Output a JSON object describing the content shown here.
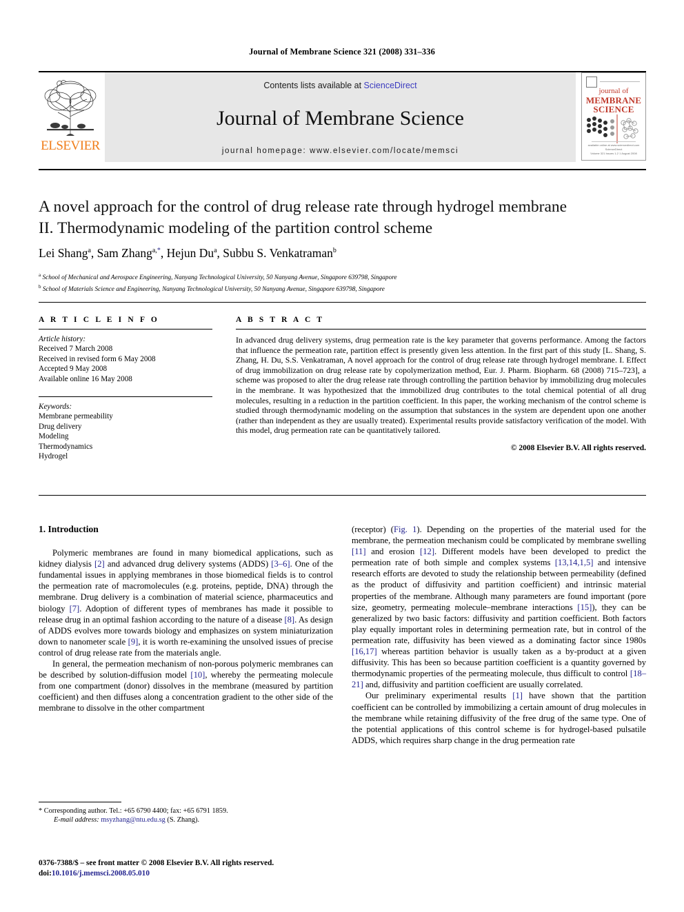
{
  "running_head": "Journal of Membrane Science 321 (2008) 331–336",
  "masthead": {
    "contents_prefix": "Contents lists available at ",
    "sciencedirect": "ScienceDirect",
    "journal_name": "Journal of Membrane Science",
    "homepage": "journal homepage: www.elsevier.com/locate/memsci",
    "publisher": "ELSEVIER",
    "publisher_logo_icon": "elsevier-tree-icon",
    "cover": {
      "line1": "journal of",
      "line2": "MEMBRANE",
      "line3": "SCIENCE",
      "footer_line1": "available online at www.sciencedirect.com",
      "footer_line2": "ScienceDirect",
      "footer_line3": "Volume 321  Issues 1-2  1 August 2008",
      "accent_color": "#c0392b"
    },
    "link_color": "#3b3bbf",
    "band_color": "#e7e7e7"
  },
  "title": {
    "line1": "A novel approach for the control of drug release rate through hydrogel membrane",
    "line2": "II. Thermodynamic modeling of the partition control scheme"
  },
  "authors": {
    "list": [
      {
        "name": "Lei Shang",
        "sup": "a"
      },
      {
        "name": "Sam Zhang",
        "sup": "a,"
      },
      {
        "name": "Hejun Du",
        "sup": "a"
      },
      {
        "name": "Subbu S. Venkatraman",
        "sup": "b"
      }
    ],
    "corresponding_marker": "*"
  },
  "affiliations": [
    {
      "sup": "a",
      "text": "School of Mechanical and Aerospace Engineering, Nanyang Technological University, 50 Nanyang Avenue, Singapore 639798, Singapore"
    },
    {
      "sup": "b",
      "text": "School of Materials Science and Engineering, Nanyang Technological University, 50 Nanyang Avenue, Singapore 639798, Singapore"
    }
  ],
  "article_info": {
    "heading": "A R T I C L E    I N F O",
    "history_label": "Article history:",
    "history": [
      "Received 7 March 2008",
      "Received in revised form 6 May 2008",
      "Accepted 9 May 2008",
      "Available online 16 May 2008"
    ],
    "keywords_label": "Keywords:",
    "keywords": [
      "Membrane permeability",
      "Drug delivery",
      "Modeling",
      "Thermodynamics",
      "Hydrogel"
    ]
  },
  "abstract": {
    "heading": "A B S T R A C T",
    "text": "In advanced drug delivery systems, drug permeation rate is the key parameter that governs performance. Among the factors that influence the permeation rate, partition effect is presently given less attention. In the first part of this study [L. Shang, S. Zhang, H. Du, S.S. Venkatraman, A novel approach for the control of drug release rate through hydrogel membrane. I. Effect of drug immobilization on drug release rate by copolymerization method, Eur. J. Pharm. Biopharm. 68 (2008) 715–723], a scheme was proposed to alter the drug release rate through controlling the partition behavior by immobilizing drug molecules in the membrane. It was hypothesized that the immobilized drug contributes to the total chemical potential of all drug molecules, resulting in a reduction in the partition coefficient. In this paper, the working mechanism of the control scheme is studied through thermodynamic modeling on the assumption that substances in the system are dependent upon one another (rather than independent as they are usually treated). Experimental results provide satisfactory verification of the model. With this model, drug permeation rate can be quantitatively tailored.",
    "copyright": "© 2008 Elsevier B.V. All rights reserved."
  },
  "body": {
    "section_heading": "1.  Introduction",
    "left_paragraphs": [
      "Polymeric membranes are found in many biomedical applications, such as kidney dialysis [2] and advanced drug delivery systems (ADDS) [3–6]. One of the fundamental issues in applying membranes in those biomedical fields is to control the permeation rate of macromolecules (e.g. proteins, peptide, DNA) through the membrane. Drug delivery is a combination of material science, pharmaceutics and biology [7]. Adoption of different types of membranes has made it possible to release drug in an optimal fashion according to the nature of a disease [8]. As design of ADDS evolves more towards biology and emphasizes on system miniaturization down to nanometer scale [9], it is worth re-examining the unsolved issues of precise control of drug release rate from the materials angle.",
      "In general, the permeation mechanism of non-porous polymeric membranes can be described by solution-diffusion model [10], whereby the permeating molecule from one compartment (donor) dissolves in the membrane (measured by partition coefficient) and then diffuses along a concentration gradient to the other side of the membrane to dissolve in the other compartment"
    ],
    "right_paragraphs": [
      "(receptor) (Fig. 1). Depending on the properties of the material used for the membrane, the permeation mechanism could be complicated by membrane swelling [11] and erosion [12]. Different models have been developed to predict the permeation rate of both simple and complex systems [13,14,1,5] and intensive research efforts are devoted to study the relationship between permeability (defined as the product of diffusivity and partition coefficient) and intrinsic material properties of the membrane. Although many parameters are found important (pore size, geometry, permeating molecule–membrane interactions [15]), they can be generalized by two basic factors: diffusivity and partition coefficient. Both factors play equally important roles in determining permeation rate, but in control of the permeation rate, diffusivity has been viewed as a dominating factor since 1980s [16,17] whereas partition behavior is usually taken as a by-product at a given diffusivity. This has been so because partition coefficient is a quantity governed by thermodynamic properties of the permeating molecule, thus difficult to control [18–21] and, diffusivity and partition coefficient are usually correlated.",
      "Our preliminary experimental results [1] have shown that the partition coefficient can be controlled by immobilizing a certain amount of drug molecules in the membrane while retaining diffusivity of the free drug of the same type. One of the potential applications of this control scheme is for hydrogel-based pulsatile ADDS, which requires sharp change in the drug permeation rate"
    ]
  },
  "footnotes": {
    "corresponding": "*  Corresponding author. Tel.: +65 6790 4400; fax: +65 6791 1859.",
    "email_label": "E-mail address:",
    "email": "msyzhang@ntu.edu.sg",
    "email_suffix": "(S. Zhang).",
    "issn_line": "0376-7388/$ – see front matter © 2008 Elsevier B.V. All rights reserved.",
    "doi_label": "doi:",
    "doi": "10.1016/j.memsci.2008.05.010"
  }
}
